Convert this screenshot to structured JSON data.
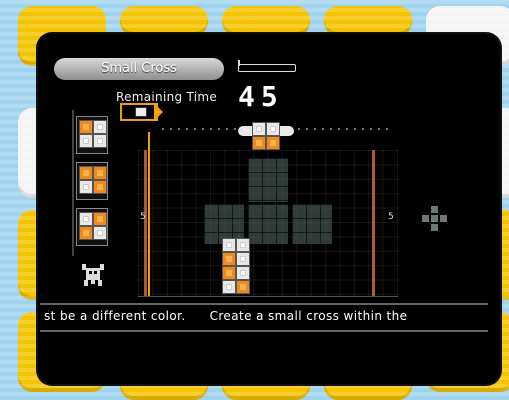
{
  "game": {
    "mode_title": "Small Cross",
    "remaining_time_label": "Remaining Time",
    "remaining_time_value": "45",
    "row_number_left": "5",
    "row_number_right": "5",
    "ticker_left": "st be a different color.",
    "ticker_right": "Create a small cross within the"
  },
  "colors": {
    "tile_yellow": "#f5c400",
    "panel": "#000000",
    "accent_orange": "#f08a1c",
    "marker": "#f0a000"
  },
  "icons": [
    "skin-marker-icon",
    "mascot-robot-icon",
    "cross-preview-icon"
  ]
}
